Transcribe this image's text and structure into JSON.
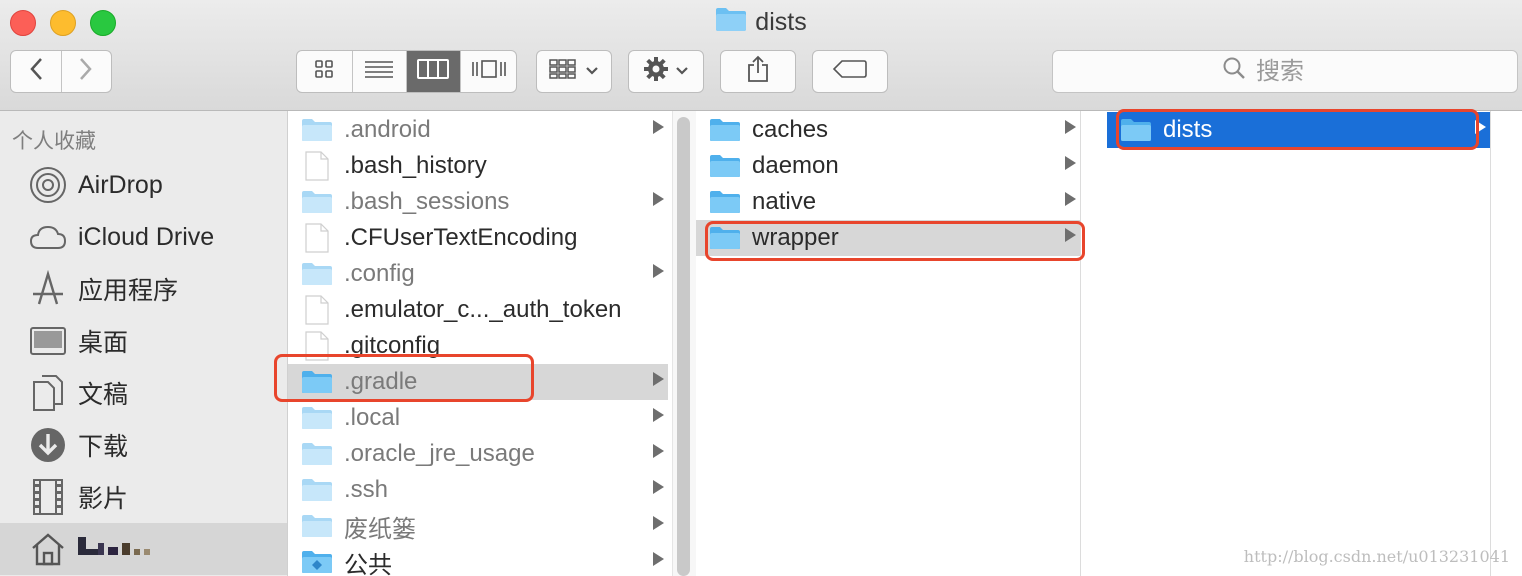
{
  "window": {
    "title": "dists"
  },
  "toolbar": {
    "back_icon": "chevron-left-icon",
    "forward_icon": "chevron-right-icon",
    "view_modes": [
      "icon-view",
      "list-view",
      "column-view",
      "cover-flow-view"
    ],
    "active_view": "column-view",
    "search_placeholder": "搜索"
  },
  "sidebar": {
    "heading": "个人收藏",
    "items": [
      {
        "label": "AirDrop",
        "icon": "airdrop-icon"
      },
      {
        "label": "iCloud Drive",
        "icon": "cloud-icon"
      },
      {
        "label": "应用程序",
        "icon": "applications-icon"
      },
      {
        "label": "桌面",
        "icon": "desktop-icon"
      },
      {
        "label": "文稿",
        "icon": "documents-icon"
      },
      {
        "label": "下载",
        "icon": "download-icon"
      },
      {
        "label": "影片",
        "icon": "film-icon"
      },
      {
        "label": "",
        "icon": "home-icon"
      }
    ]
  },
  "columns": [
    {
      "items": [
        {
          "name": ".android",
          "type": "folder",
          "arrow": true
        },
        {
          "name": ".bash_history",
          "type": "file",
          "arrow": false
        },
        {
          "name": ".bash_sessions",
          "type": "folder",
          "arrow": true
        },
        {
          "name": ".CFUserTextEncoding",
          "type": "file",
          "arrow": false
        },
        {
          "name": ".config",
          "type": "folder",
          "arrow": true
        },
        {
          "name": ".emulator_c..._auth_token",
          "type": "file",
          "arrow": false
        },
        {
          "name": ".gitconfig",
          "type": "file",
          "arrow": false
        },
        {
          "name": ".gradle",
          "type": "folder",
          "arrow": true,
          "selected": "gray"
        },
        {
          "name": ".local",
          "type": "folder",
          "arrow": true
        },
        {
          "name": ".oracle_jre_usage",
          "type": "folder",
          "arrow": true
        },
        {
          "name": ".ssh",
          "type": "folder",
          "arrow": true
        },
        {
          "name": "废纸篓",
          "type": "folder",
          "arrow": true
        },
        {
          "name": "公共",
          "type": "public-folder",
          "arrow": true
        }
      ]
    },
    {
      "items": [
        {
          "name": "caches",
          "type": "folder",
          "arrow": true
        },
        {
          "name": "daemon",
          "type": "folder",
          "arrow": true
        },
        {
          "name": "native",
          "type": "folder",
          "arrow": true
        },
        {
          "name": "wrapper",
          "type": "folder",
          "arrow": true,
          "selected": "gray"
        }
      ]
    },
    {
      "items": [
        {
          "name": "dists",
          "type": "folder",
          "arrow": true,
          "selected": "blue"
        }
      ]
    }
  ],
  "watermark": "http://blog.csdn.net/u013231041",
  "colors": {
    "selection_blue": "#1a6fd8",
    "highlight_red": "#e8452c",
    "folder_blue": "#5db8f0"
  }
}
